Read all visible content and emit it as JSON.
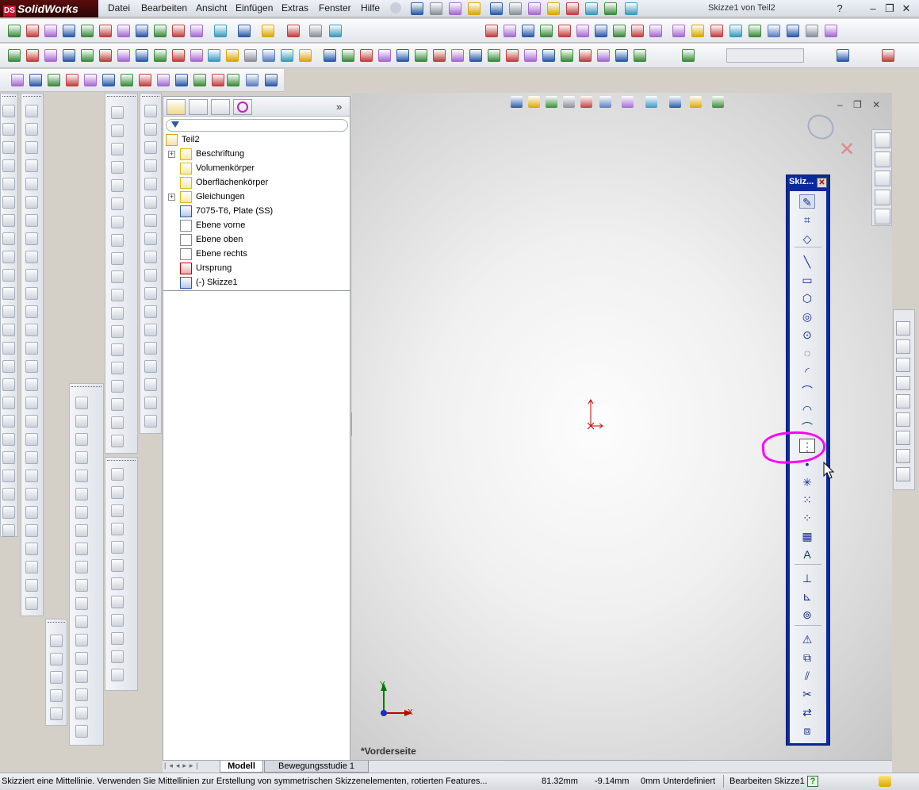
{
  "app": {
    "name": "SolidWorks",
    "logo_mark": "DS",
    "window_title": "Skizze1 von Teil2"
  },
  "menu": [
    "Datei",
    "Bearbeiten",
    "Ansicht",
    "Einfügen",
    "Extras",
    "Fenster",
    "Hilfe"
  ],
  "window_controls": {
    "help": "?",
    "minimize": "–",
    "restore": "❐",
    "close": "✕"
  },
  "feature_tree": {
    "collapse_label": "»",
    "items": [
      {
        "label": "Teil2",
        "icon": "part-icon",
        "expandable": false,
        "indent": 0
      },
      {
        "label": "Beschriftung",
        "icon": "annotation-icon",
        "expandable": true,
        "indent": 1
      },
      {
        "label": "Volumenkörper",
        "icon": "solid-bodies-icon",
        "expandable": false,
        "indent": 1
      },
      {
        "label": "Oberflächenkörper",
        "icon": "surface-bodies-icon",
        "expandable": false,
        "indent": 1
      },
      {
        "label": "Gleichungen",
        "icon": "equations-icon",
        "expandable": true,
        "indent": 1
      },
      {
        "label": "7075-T6, Plate (SS)",
        "icon": "material-icon",
        "expandable": false,
        "indent": 1
      },
      {
        "label": "Ebene vorne",
        "icon": "plane-icon",
        "expandable": false,
        "indent": 1
      },
      {
        "label": "Ebene oben",
        "icon": "plane-icon",
        "expandable": false,
        "indent": 1
      },
      {
        "label": "Ebene rechts",
        "icon": "plane-icon",
        "expandable": false,
        "indent": 1
      },
      {
        "label": "Ursprung",
        "icon": "origin-icon",
        "expandable": false,
        "indent": 1
      },
      {
        "label": "(-) Skizze1",
        "icon": "sketch-icon",
        "expandable": false,
        "indent": 1
      }
    ]
  },
  "viewport": {
    "view_label": "*Vorderseite",
    "axis_x": "X",
    "axis_y": "Y"
  },
  "sketch_toolbar": {
    "title": "Skiz...",
    "close": "✕",
    "tools": [
      {
        "name": "sketch-icon",
        "glyph": "✎"
      },
      {
        "name": "3d-sketch-icon",
        "glyph": "⌗"
      },
      {
        "name": "smart-dimension-icon",
        "glyph": "◇"
      },
      {
        "name": "line-icon",
        "glyph": "╲"
      },
      {
        "name": "rectangle-icon",
        "glyph": "▭"
      },
      {
        "name": "polygon-icon",
        "glyph": "⬡"
      },
      {
        "name": "circle-icon",
        "glyph": "◎"
      },
      {
        "name": "perimeter-circle-icon",
        "glyph": "⊙"
      },
      {
        "name": "centerpoint-arc-icon",
        "glyph": "◌"
      },
      {
        "name": "tangent-arc-icon",
        "glyph": "◜"
      },
      {
        "name": "three-point-arc-icon",
        "glyph": "⌒"
      },
      {
        "name": "ellipse-icon",
        "glyph": "◠"
      },
      {
        "name": "parabola-icon",
        "glyph": "⌒"
      },
      {
        "name": "centerline-icon",
        "glyph": "⋮"
      },
      {
        "name": "point-icon",
        "glyph": "•"
      },
      {
        "name": "sketch-point-icon",
        "glyph": "✳"
      },
      {
        "name": "linear-pattern-icon",
        "glyph": "⁙"
      },
      {
        "name": "circular-pattern-icon",
        "glyph": "⁘"
      },
      {
        "name": "grid-icon",
        "glyph": "▦"
      },
      {
        "name": "text-icon",
        "glyph": "A"
      },
      {
        "name": "add-relation-icon",
        "glyph": "⊥"
      },
      {
        "name": "display-relations-icon",
        "glyph": "⊾"
      },
      {
        "name": "scan-equal-icon",
        "glyph": "⊚"
      },
      {
        "name": "mirror-icon",
        "glyph": "⚠"
      },
      {
        "name": "convert-entities-icon",
        "glyph": "⧉"
      },
      {
        "name": "offset-entities-icon",
        "glyph": "⫽"
      },
      {
        "name": "trim-entities-icon",
        "glyph": "✂"
      },
      {
        "name": "move-entities-icon",
        "glyph": "⇄"
      },
      {
        "name": "copy-entities-icon",
        "glyph": "⧈"
      }
    ]
  },
  "bottom_tabs": [
    "Modell",
    "Bewegungsstudie 1"
  ],
  "status": {
    "message": "Skizziert eine Mittellinie. Verwenden Sie Mittellinien zur Erstellung von symmetrischen Skizzenelementen, rotierten Features...",
    "x": "81.32mm",
    "y": "-9.14mm",
    "z": "0mm",
    "state": "Unterdefiniert",
    "mode": "Bearbeiten Skizze1",
    "help": "?"
  },
  "colors": {
    "highlight": "#ff00ff",
    "sketch_toolbar_frame": "#0a2a9c",
    "axis_x": "#c00000",
    "axis_y": "#007a00"
  }
}
